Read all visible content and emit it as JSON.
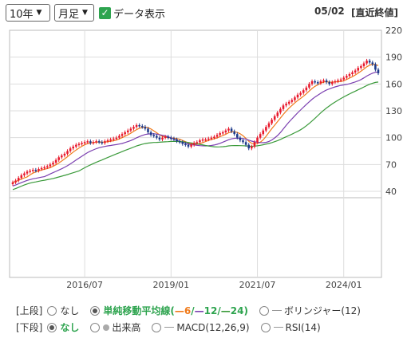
{
  "controls": {
    "period": "10年",
    "interval": "月足",
    "show_data_label": "データ表示",
    "show_data_checked": true,
    "date": "05/02",
    "date_note": "[直近終値]"
  },
  "options": {
    "upper_label": "[上段]",
    "lower_label": "[下段]",
    "upper": [
      {
        "label": "なし",
        "selected": false
      },
      {
        "label": "単純移動平均線(",
        "selected": true,
        "ma6": "6",
        "sep1": "/",
        "ma12": "12",
        "sep2": "/",
        "ma24": "24",
        "close": ")"
      },
      {
        "label": "ボリンジャー(12)",
        "selected": false
      }
    ],
    "lower": [
      {
        "label": "なし",
        "selected": true
      },
      {
        "label": "出来高",
        "selected": false
      },
      {
        "label": "MACD(12,26,9)",
        "selected": false
      },
      {
        "label": "RSI(14)",
        "selected": false
      }
    ]
  },
  "chart_data": {
    "type": "candlestick",
    "y_ticks": [
      220,
      190,
      160,
      130,
      100,
      70,
      40
    ],
    "ylim": [
      40,
      220
    ],
    "x_ticks": [
      "2016/07",
      "2019/01",
      "2021/07",
      "2024/01"
    ],
    "start_month": "2014/06",
    "close": [
      50,
      52,
      55,
      58,
      60,
      62,
      63,
      64,
      63,
      65,
      66,
      67,
      68,
      70,
      72,
      75,
      78,
      80,
      82,
      85,
      88,
      90,
      92,
      93,
      94,
      95,
      96,
      94,
      95,
      96,
      95,
      94,
      96,
      97,
      98,
      99,
      100,
      102,
      104,
      106,
      108,
      110,
      112,
      114,
      113,
      112,
      110,
      106,
      103,
      102,
      100,
      98,
      100,
      101,
      100,
      99,
      98,
      96,
      95,
      93,
      92,
      90,
      92,
      94,
      95,
      97,
      98,
      98,
      99,
      100,
      101,
      103,
      105,
      106,
      108,
      110,
      107,
      104,
      100,
      97,
      95,
      92,
      88,
      90,
      95,
      100,
      104,
      108,
      112,
      116,
      120,
      124,
      128,
      132,
      136,
      138,
      140,
      142,
      145,
      148,
      150,
      153,
      156,
      160,
      163,
      162,
      161,
      163,
      164,
      162,
      160,
      162,
      163,
      164,
      165,
      167,
      169,
      171,
      173,
      175,
      178,
      180,
      183,
      186,
      184,
      182,
      176,
      172
    ],
    "colors": {
      "up": "#e8192c",
      "down": "#1e3a8a",
      "ma6": "#f07a1a",
      "ma12": "#7b3fb0",
      "ma24": "#3a9a3a"
    },
    "ma_periods": [
      6,
      12,
      24
    ]
  }
}
